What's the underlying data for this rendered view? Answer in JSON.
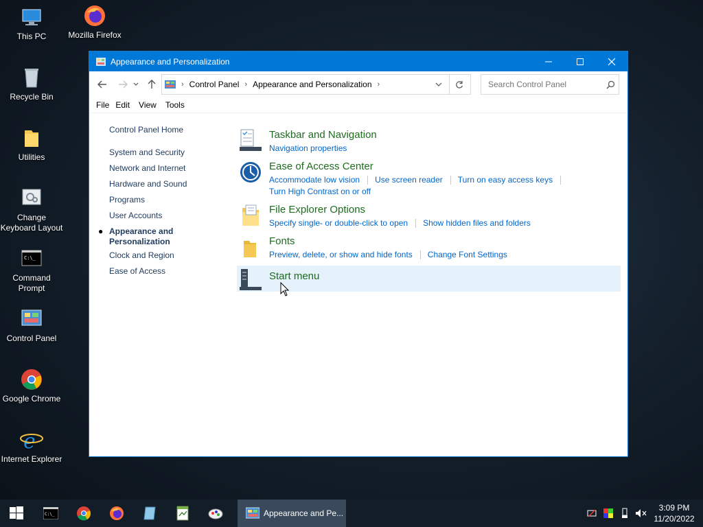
{
  "desktop": {
    "icons": [
      {
        "label": "This PC"
      },
      {
        "label": "Mozilla Firefox"
      },
      {
        "label": "Recycle Bin"
      },
      {
        "label": "Utilities"
      },
      {
        "label": "Change Keyboard Layout"
      },
      {
        "label": "Command Prompt"
      },
      {
        "label": "Control Panel"
      },
      {
        "label": "Google Chrome"
      },
      {
        "label": "Internet Explorer"
      }
    ]
  },
  "window": {
    "title": "Appearance and Personalization",
    "address": {
      "crumbs": [
        "Control Panel",
        "Appearance and Personalization"
      ]
    },
    "search": {
      "placeholder": "Search Control Panel"
    },
    "menu": [
      "File",
      "Edit",
      "View",
      "Tools"
    ],
    "leftnav": {
      "home": "Control Panel Home",
      "items": [
        "System and Security",
        "Network and Internet",
        "Hardware and Sound",
        "Programs",
        "User Accounts",
        "Appearance and Personalization",
        "Clock and Region",
        "Ease of Access"
      ],
      "current_index": 5
    },
    "categories": [
      {
        "title": "Taskbar and Navigation",
        "links": [
          "Navigation properties"
        ]
      },
      {
        "title": "Ease of Access Center",
        "links": [
          "Accommodate low vision",
          "Use screen reader",
          "Turn on easy access keys",
          "Turn High Contrast on or off"
        ]
      },
      {
        "title": "File Explorer Options",
        "links": [
          "Specify single- or double-click to open",
          "Show hidden files and folders"
        ]
      },
      {
        "title": "Fonts",
        "links": [
          "Preview, delete, or show and hide fonts",
          "Change Font Settings"
        ]
      },
      {
        "title": "Start menu",
        "links": []
      }
    ]
  },
  "taskbar": {
    "active_window": "Appearance and Pe...",
    "time": "3:09 PM",
    "date": "11/20/2022"
  },
  "colors": {
    "accent": "#0078d7",
    "category_title": "#1e6b1e",
    "link": "#0066cc",
    "hover": "#e5f1fb"
  }
}
